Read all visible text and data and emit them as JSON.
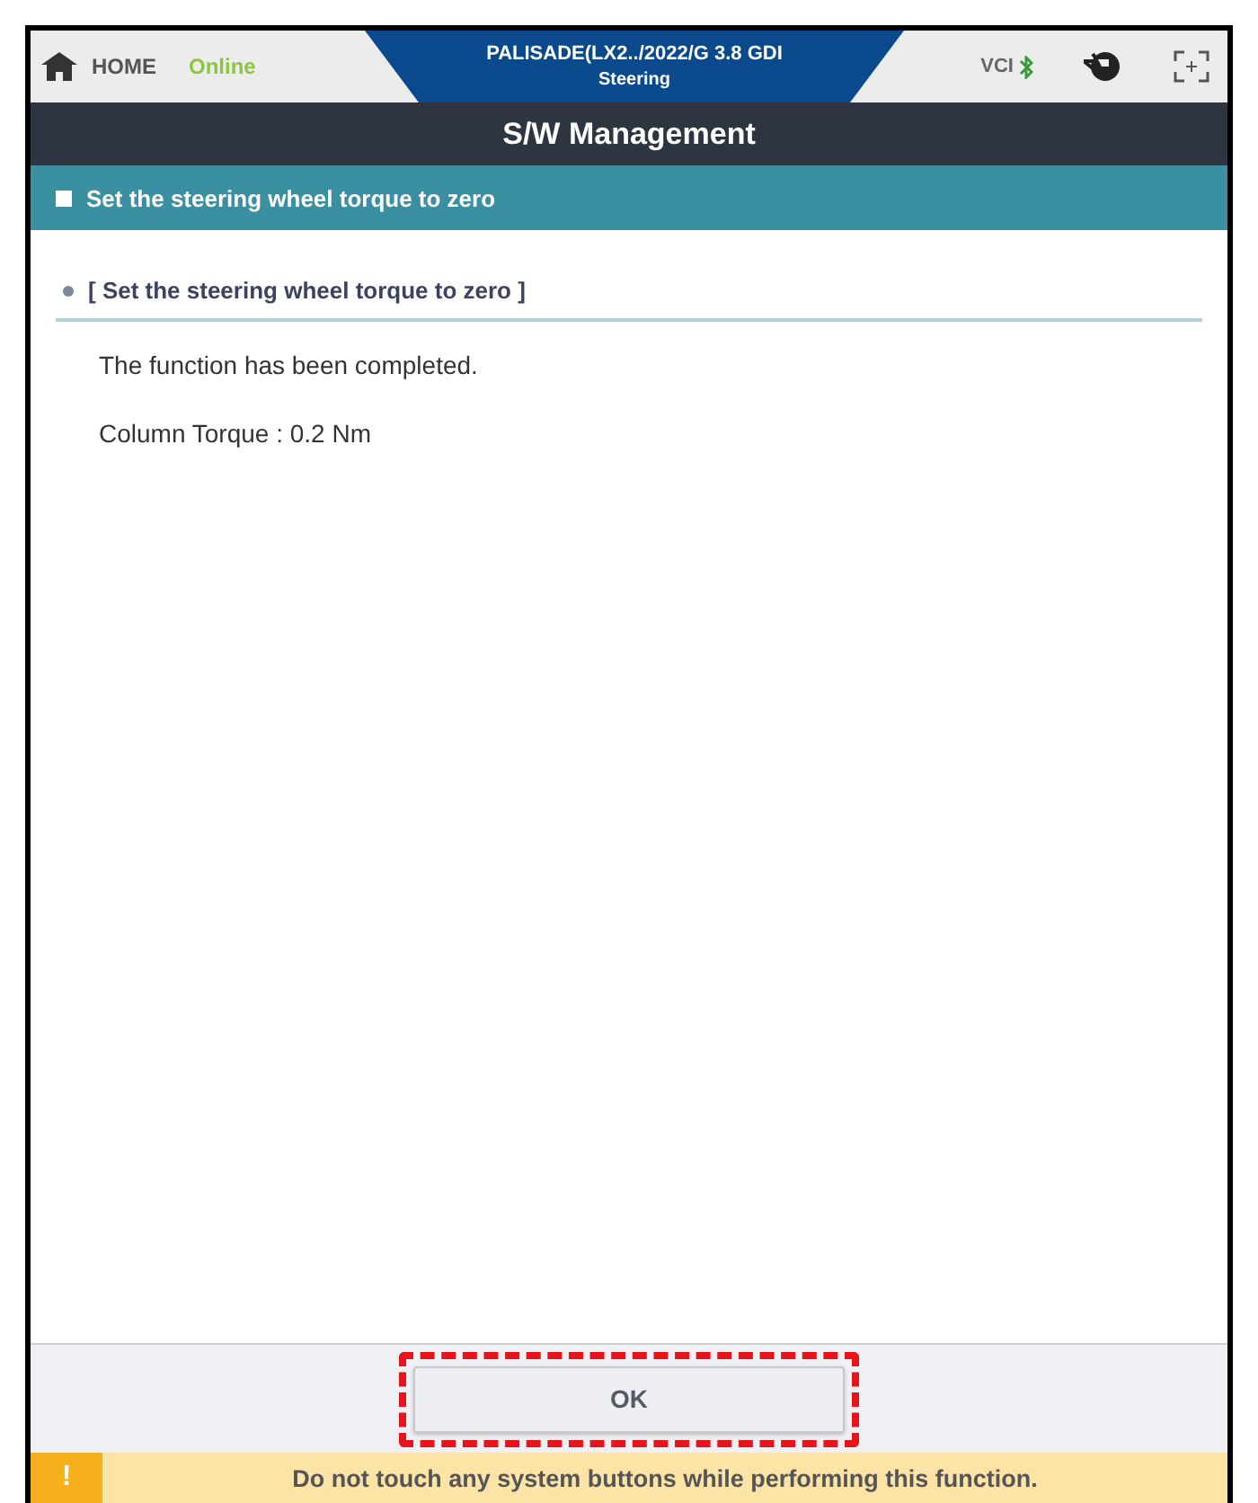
{
  "header": {
    "home_label": "HOME",
    "status": "Online",
    "vehicle": "PALISADE(LX2../2022/G 3.8 GDI",
    "system": "Steering",
    "vci_label": "VCI"
  },
  "title_bar": {
    "title": "S/W Management"
  },
  "section_bar": {
    "title": "Set the steering wheel torque to zero"
  },
  "content": {
    "heading": "[ Set the steering wheel torque to zero ]",
    "lines": [
      "The function has been completed.",
      "Column Torque : 0.2 Nm"
    ]
  },
  "footer": {
    "button": {
      "label": "OK",
      "highlighted": true
    }
  },
  "warning": {
    "icon": "!",
    "text": "Do not touch any system buttons while performing this function."
  }
}
